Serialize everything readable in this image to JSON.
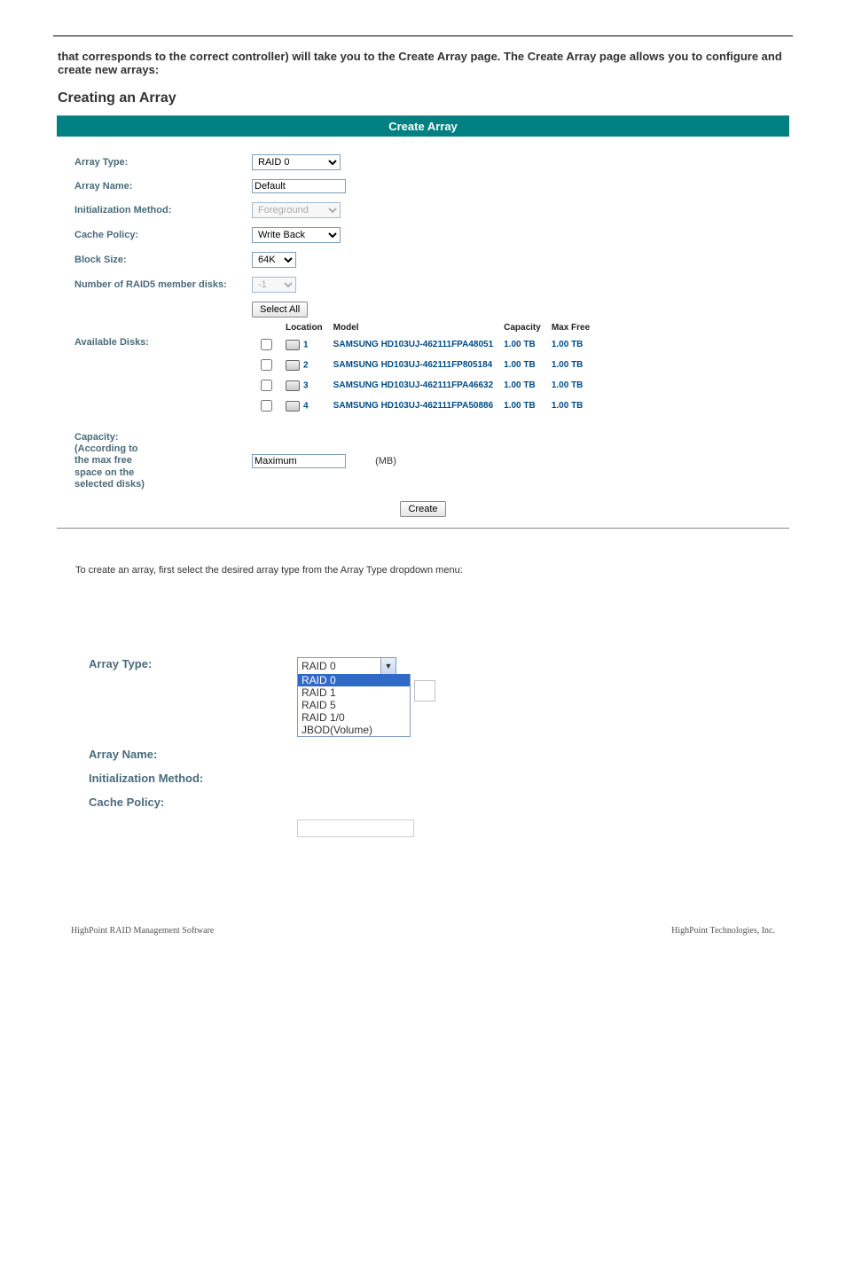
{
  "intro_text": "that corresponds to the correct controller) will take you to the Create Array page. The Create Array page allows you to configure and create new arrays:",
  "heading_create_array": "Creating an Array",
  "panel_title": "Create Array",
  "labels": {
    "array_type": "Array Type:",
    "array_name": "Array Name:",
    "init_method": "Initialization Method:",
    "cache_policy": "Cache Policy:",
    "block_size": "Block Size:",
    "raid5_members": "Number of RAID5 member disks:",
    "available_disks": "Available Disks:",
    "capacity": "Capacity:\n(According to\nthe max free\nspace on the\nselected disks)",
    "mb": "(MB)"
  },
  "values": {
    "array_type": "RAID 0",
    "array_name": "Default",
    "init_method": "Foreground",
    "cache_policy": "Write Back",
    "block_size": "64K",
    "raid5_members": "-1",
    "capacity": "Maximum"
  },
  "buttons": {
    "select_all": "Select All",
    "create": "Create"
  },
  "disk_headers": {
    "location": "Location",
    "model": "Model",
    "capacity": "Capacity",
    "max_free": "Max Free"
  },
  "disks": [
    {
      "location": "1",
      "model": "SAMSUNG HD103UJ-462111FPA48051",
      "capacity": "1.00 TB",
      "max_free": "1.00 TB"
    },
    {
      "location": "2",
      "model": "SAMSUNG HD103UJ-462111FP805184",
      "capacity": "1.00 TB",
      "max_free": "1.00 TB"
    },
    {
      "location": "3",
      "model": "SAMSUNG HD103UJ-462111FPA46632",
      "capacity": "1.00 TB",
      "max_free": "1.00 TB"
    },
    {
      "location": "4",
      "model": "SAMSUNG HD103UJ-462111FPA50886",
      "capacity": "1.00 TB",
      "max_free": "1.00 TB"
    }
  ],
  "section2": {
    "intro": "To create an array, first select the desired array type from the Array Type dropdown menu:",
    "labels": {
      "array_type": "Array Type:",
      "array_name": "Array Name:",
      "init_method": "Initialization Method:",
      "cache_policy": "Cache Policy:"
    },
    "combo_value": "RAID 0",
    "options": [
      "RAID 0",
      "RAID 1",
      "RAID 5",
      "RAID 1/0",
      "JBOD(Volume)"
    ]
  },
  "footer": {
    "left": "HighPoint RAID Management Software",
    "right": "HighPoint Technologies, Inc."
  }
}
